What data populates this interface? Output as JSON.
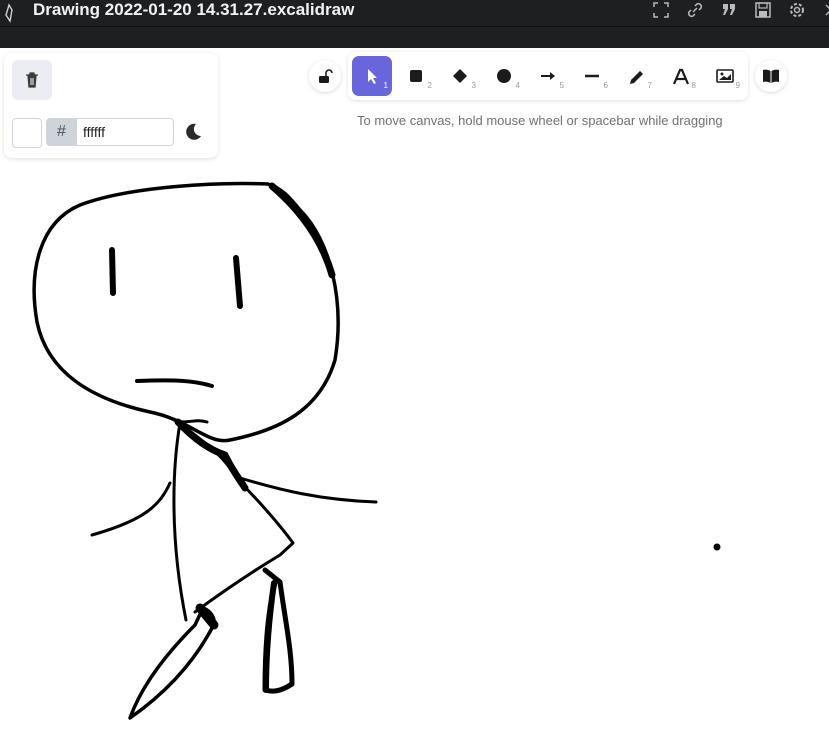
{
  "window": {
    "title": "Drawing 2022-01-20 14.31.27.excalidraw"
  },
  "title_actions": [
    "fullscreen-icon",
    "link-icon",
    "quote-icon",
    "save-icon",
    "settings-icon",
    "close-icon"
  ],
  "properties": {
    "color_hash": "#",
    "color_value": "ffffff",
    "swatch_color": "#ffffff"
  },
  "toolbar": {
    "tools": [
      {
        "name": "selection",
        "icon": "pointer-icon",
        "key": "1",
        "active": true
      },
      {
        "name": "rectangle",
        "icon": "square-icon",
        "key": "2"
      },
      {
        "name": "diamond",
        "icon": "diamond-icon",
        "key": "3"
      },
      {
        "name": "ellipse",
        "icon": "circle-icon",
        "key": "4"
      },
      {
        "name": "arrow",
        "icon": "arrow-icon",
        "key": "5"
      },
      {
        "name": "line",
        "icon": "line-icon",
        "key": "6"
      },
      {
        "name": "draw",
        "icon": "pencil-icon",
        "key": "7"
      },
      {
        "name": "text",
        "icon": "text-icon",
        "key": "8"
      },
      {
        "name": "image",
        "icon": "image-icon",
        "key": "9"
      }
    ],
    "accent": "#6965db"
  },
  "hint": "To move canvas, hold mouse wheel or spacebar while dragging"
}
